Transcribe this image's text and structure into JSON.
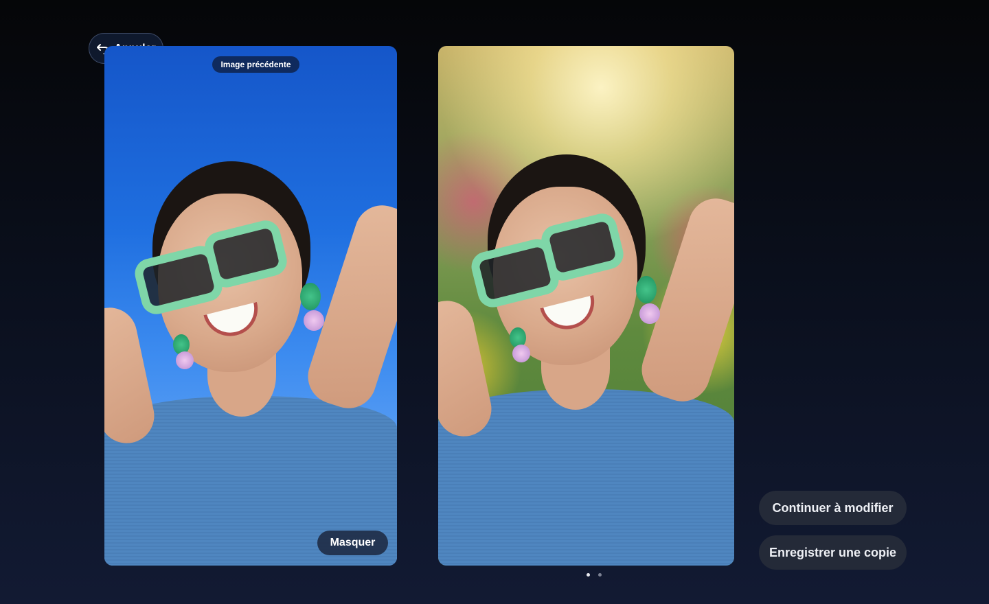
{
  "header": {
    "back_label": "Annuler",
    "back_icon": "undo-arrow-icon"
  },
  "original_photo": {
    "tag_label": "Image précédente",
    "mask_label": "Masquer"
  },
  "actions": {
    "continue_label": "Continuer à modifier",
    "save_copy_label": "Enregistrer une copie"
  },
  "pagination": {
    "pages": 2,
    "active_index": 0
  },
  "colors": {
    "background_top": "#050608",
    "background_bottom": "#121a33",
    "button_bg": "#242a38",
    "original_sky": "#1f6fe0",
    "glasses_frame": "#7fd6a8",
    "shirt": "#4f86c0"
  }
}
